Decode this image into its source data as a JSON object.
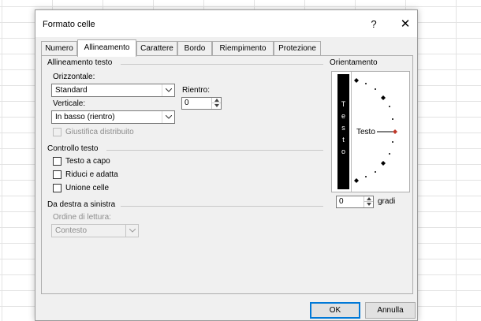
{
  "dialog": {
    "title": "Formato celle",
    "help": "?",
    "close": "✕"
  },
  "tabs": [
    {
      "label": "Numero"
    },
    {
      "label": "Allineamento",
      "active": true
    },
    {
      "label": "Carattere"
    },
    {
      "label": "Bordo"
    },
    {
      "label": "Riempimento"
    },
    {
      "label": "Protezione"
    }
  ],
  "alignment": {
    "section": "Allineamento testo",
    "horizontal_label": "Orizzontale:",
    "horizontal_value": "Standard",
    "indent_label": "Rientro:",
    "indent_value": "0",
    "vertical_label": "Verticale:",
    "vertical_value": "In basso (rientro)",
    "justify_distributed": "Giustifica distribuito"
  },
  "text_control": {
    "section": "Controllo testo",
    "wrap": "Testo a capo",
    "shrink": "Riduci e adatta",
    "merge": "Unione celle"
  },
  "rtl": {
    "section": "Da destra a sinistra",
    "reading_order_label": "Ordine di lettura:",
    "reading_order_value": "Contesto"
  },
  "orientation": {
    "section": "Orientamento",
    "vertical_text": [
      "T",
      "e",
      "s",
      "t",
      "o"
    ],
    "dial_label": "Testo",
    "degrees_value": "0",
    "degrees_label": "gradi"
  },
  "buttons": {
    "ok": "OK",
    "cancel": "Annulla"
  },
  "colors": {
    "accent": "#0078d7",
    "dial_marker": "#c0392b"
  }
}
